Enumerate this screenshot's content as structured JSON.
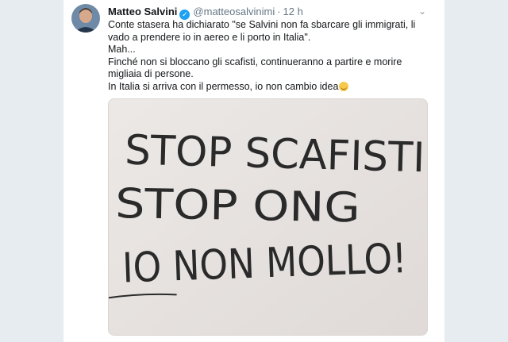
{
  "tweet": {
    "author_name": "Matteo Salvini",
    "handle": "@matteosalvinimi",
    "separator": "·",
    "time": "12 h",
    "text_lines": [
      "Conte stasera ha dichiarato \"se Salvini non fa sbarcare gli immigrati, li vado a prendere io in aereo e li porto in Italia\".",
      "Mah...",
      "Finché non si bloccano gli scafisti, continueranno a partire e morire migliaia di persone.",
      "In Italia si arriva con il permesso, io non cambio idea"
    ]
  },
  "media": {
    "handwriting_lines": [
      "STOP SCAFISTI",
      "STOP ONG",
      "IO NON MOLLO!"
    ]
  },
  "icons": {
    "verified": "verified-badge-icon",
    "more": "chevron-down-icon",
    "emoji": "smiling-face-emoji"
  }
}
